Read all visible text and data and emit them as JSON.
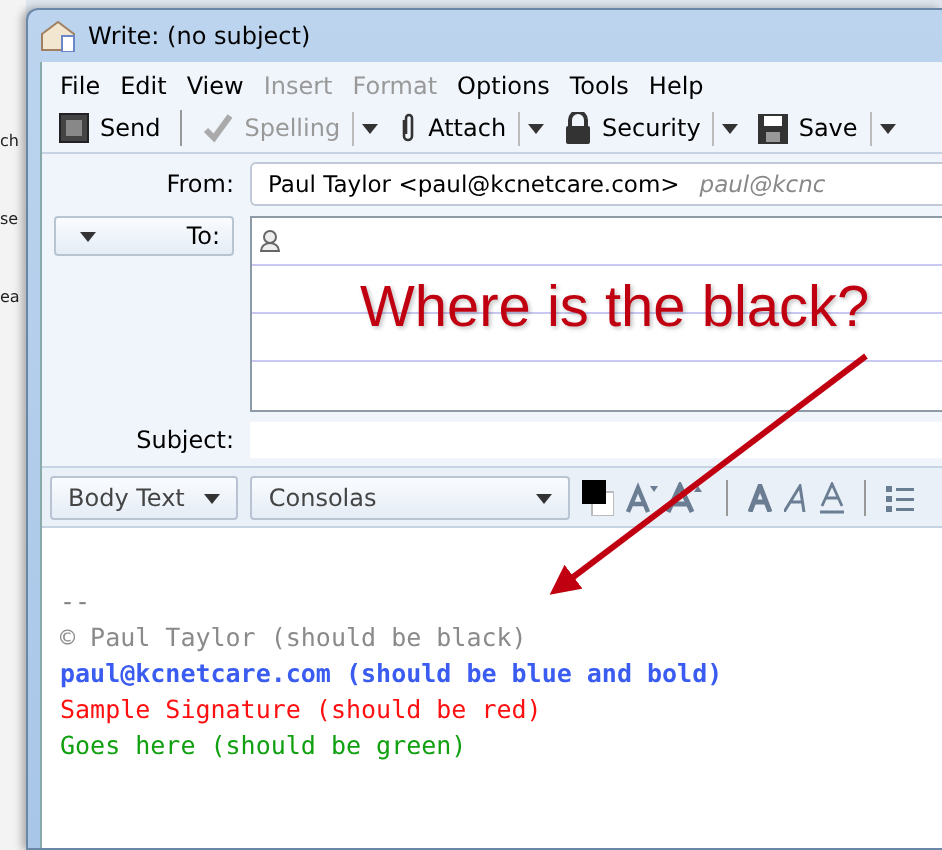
{
  "background_window": {
    "fragments": [
      "ch",
      "se",
      "ea"
    ]
  },
  "window": {
    "title": "Write: (no subject)"
  },
  "menu": [
    {
      "label": "File",
      "disabled": false
    },
    {
      "label": "Edit",
      "disabled": false
    },
    {
      "label": "View",
      "disabled": false
    },
    {
      "label": "Insert",
      "disabled": true
    },
    {
      "label": "Format",
      "disabled": true
    },
    {
      "label": "Options",
      "disabled": false
    },
    {
      "label": "Tools",
      "disabled": false
    },
    {
      "label": "Help",
      "disabled": false
    }
  ],
  "toolbar": [
    {
      "kind": "send",
      "label": "Send",
      "disabled": false,
      "dropdown": false
    },
    {
      "kind": "spelling",
      "label": "Spelling",
      "disabled": true,
      "dropdown": true
    },
    {
      "kind": "attach",
      "label": "Attach",
      "disabled": false,
      "dropdown": true
    },
    {
      "kind": "security",
      "label": "Security",
      "disabled": false,
      "dropdown": true
    },
    {
      "kind": "save",
      "label": "Save",
      "disabled": false,
      "dropdown": true
    }
  ],
  "header": {
    "from_label": "From:",
    "from_value": "Paul Taylor <paul@kcnetcare.com>",
    "from_identity": "paul@kcnc",
    "to_label": "To:",
    "subject_label": "Subject:"
  },
  "format_bar": {
    "paragraph_style": "Body Text",
    "font": "Consolas"
  },
  "body": {
    "lines": [
      {
        "text": "--",
        "color": "#808080",
        "bold": false
      },
      {
        "text": "© Paul Taylor (should be black)",
        "color": "#8a8a8a",
        "bold": false
      },
      {
        "text": "paul@kcnetcare.com (should be blue and bold)",
        "color": "#3a5cf0",
        "bold": true
      },
      {
        "text": "Sample Signature (should be red)",
        "color": "#ff1010",
        "bold": false
      },
      {
        "text": "Goes here (should be green)",
        "color": "#10a010",
        "bold": false
      }
    ]
  },
  "annotation": {
    "text": "Where is the black?"
  }
}
